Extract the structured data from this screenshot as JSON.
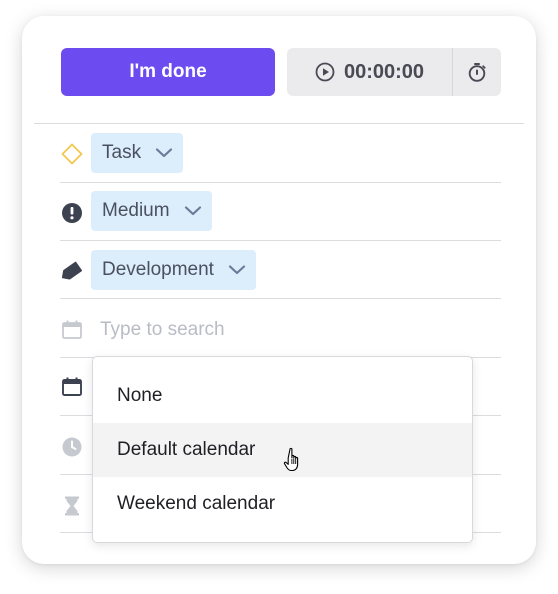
{
  "toolbar": {
    "done_label": "I'm done",
    "timer_value": "00:00:00",
    "timer_icon": "play-circle-icon",
    "estimate_icon": "stopwatch-icon"
  },
  "fields": {
    "type": {
      "value": "Task",
      "icon": "diamond-icon"
    },
    "priority": {
      "value": "Medium",
      "icon": "exclamation-circle-icon"
    },
    "category": {
      "value": "Development",
      "icon": "tag-icon"
    },
    "calendar_search": {
      "placeholder": "Type to search",
      "icon": "calendar-icon"
    },
    "other_rows": [
      {
        "icon": "calendar-icon"
      },
      {
        "icon": "clock-icon"
      },
      {
        "icon": "hourglass-icon"
      }
    ]
  },
  "dropdown": {
    "options": [
      {
        "label": "None"
      },
      {
        "label": "Default calendar"
      },
      {
        "label": "Weekend calendar"
      }
    ],
    "hovered_index": 1
  },
  "colors": {
    "primary": "#6c4cf0",
    "chip_bg": "#dcedfb",
    "diamond": "#f2c94c"
  }
}
